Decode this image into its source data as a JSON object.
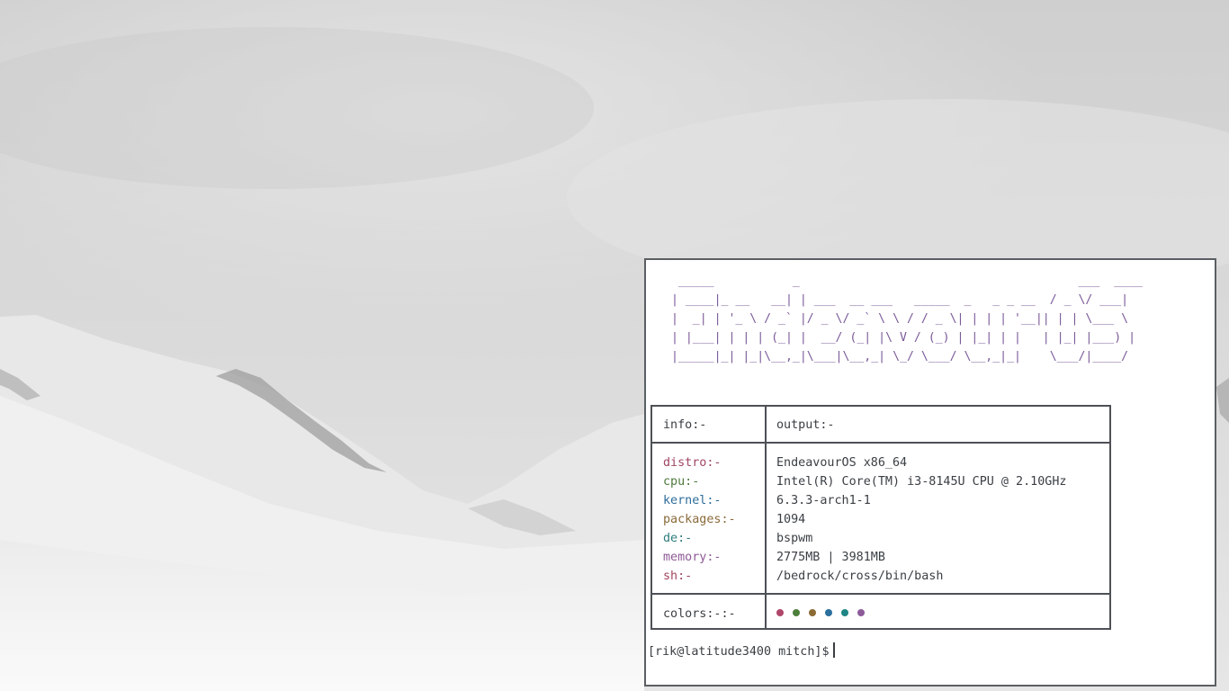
{
  "terminal": {
    "ascii_banner": "  _____           _                                       ___  ____\n | ____|_ __   __| | ___  __ ___   _____  _   _ _ __  / _ \\/ ___|\n |  _| | '_ \\ / _` |/ _ \\/ _` \\ \\ / / _ \\| | | | '__|| | | \\___ \\\n | |___| | | | (_| |  __/ (_| |\\ V / (_) | |_| | |   | |_| |___) |\n |_____|_| |_|\\__,_|\\___|\\__,_| \\_/ \\___/ \\__,_|_|    \\___/|____/",
    "header": {
      "info": "info:-",
      "output": "output:-"
    },
    "rows": [
      {
        "label": "distro:-",
        "value": "EndeavourOS x86_64",
        "color": "#a1465f"
      },
      {
        "label": "cpu:-",
        "value": "Intel(R) Core(TM) i3-8145U CPU @ 2.10GHz",
        "color": "#4e7a3c"
      },
      {
        "label": "kernel:-",
        "value": "6.3.3-arch1-1",
        "color": "#2e6d9b"
      },
      {
        "label": "packages:-",
        "value": "1094",
        "color": "#8a6a3a"
      },
      {
        "label": "de:-",
        "value": "bspwm",
        "color": "#2e7d7d"
      },
      {
        "label": "memory:-",
        "value": "2775MB | 3981MB",
        "color": "#8d5a95"
      },
      {
        "label": "sh:-",
        "value": "/bedrock/cross/bin/bash",
        "color": "#a1465f"
      }
    ],
    "colors_label": "colors:-:-",
    "palette": [
      "#b0466a",
      "#4d7f3c",
      "#8b6a35",
      "#2a6f9d",
      "#1f8585",
      "#8d5a9a"
    ],
    "prompt": "[rik@latitude3400 mitch]$"
  }
}
